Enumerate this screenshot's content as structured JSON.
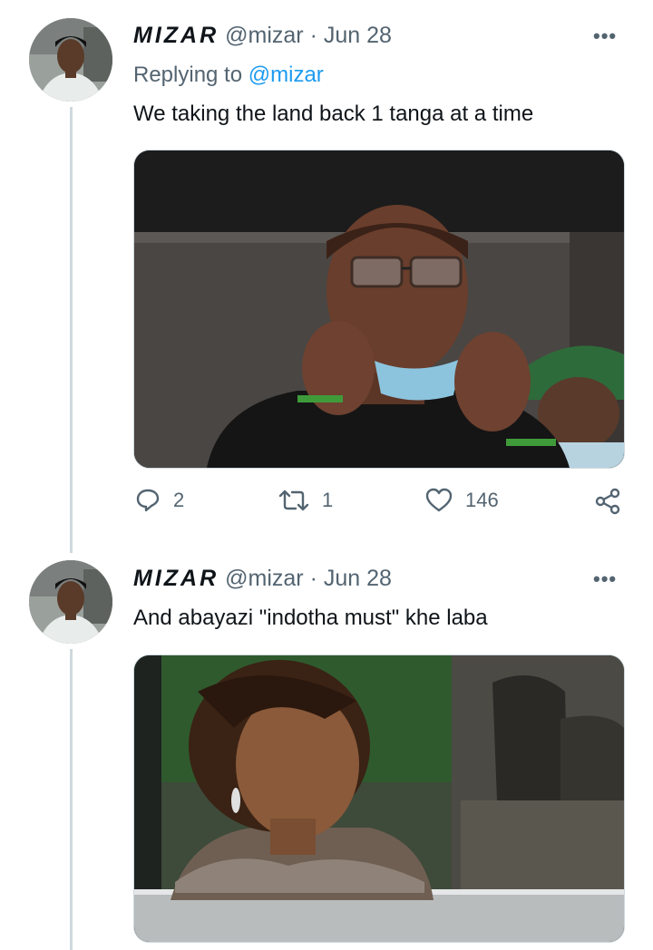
{
  "tweets": [
    {
      "display_name": "MIZAR",
      "handle": "@mizar",
      "separator": "·",
      "date": "Jun 28",
      "more_icon": "more-icon",
      "reply_prefix": "Replying to",
      "reply_handle": "@mizar",
      "text": "We taking the land back 1 tanga at a time",
      "actions": {
        "reply_count": "2",
        "retweet_count": "1",
        "like_count": "146"
      }
    },
    {
      "display_name": "MIZAR",
      "handle": "@mizar",
      "separator": "·",
      "date": "Jun 28",
      "more_icon": "more-icon",
      "text": "And abayazi \"indotha must\" khe laba"
    }
  ],
  "colors": {
    "secondary_text": "#536471",
    "link": "#1d9bf0",
    "thread_line": "#cfd9de"
  }
}
